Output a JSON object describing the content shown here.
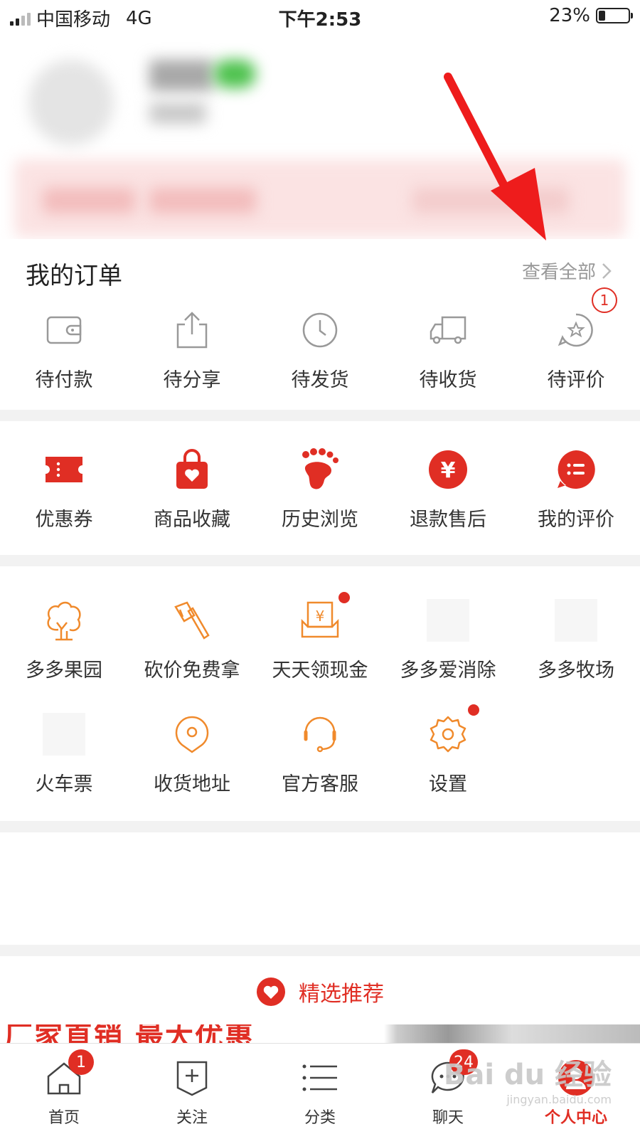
{
  "status_bar": {
    "carrier": "中国移动",
    "network": "4G",
    "time": "下午2:53",
    "battery": "23%",
    "battery_level": 0.23
  },
  "orders": {
    "title": "我的订单",
    "view_all": "查看全部",
    "items": [
      {
        "label": "待付款",
        "icon": "wallet-icon"
      },
      {
        "label": "待分享",
        "icon": "share-icon"
      },
      {
        "label": "待发货",
        "icon": "clock-icon"
      },
      {
        "label": "待收货",
        "icon": "truck-icon"
      },
      {
        "label": "待评价",
        "icon": "review-icon",
        "badge": "1"
      }
    ]
  },
  "services": [
    {
      "label": "优惠券",
      "icon": "coupon-icon"
    },
    {
      "label": "商品收藏",
      "icon": "favorites-bag-icon"
    },
    {
      "label": "历史浏览",
      "icon": "footprint-icon"
    },
    {
      "label": "退款售后",
      "icon": "refund-icon"
    },
    {
      "label": "我的评价",
      "icon": "my-reviews-icon"
    }
  ],
  "tools": [
    {
      "label": "多多果园",
      "icon": "tree-icon"
    },
    {
      "label": "砍价免费拿",
      "icon": "axe-icon"
    },
    {
      "label": "天天领现金",
      "icon": "cash-icon"
    },
    {
      "label": "多多爱消除",
      "icon": "placeholder-icon"
    },
    {
      "label": "多多牧场",
      "icon": "placeholder-icon"
    },
    {
      "label": "火车票",
      "icon": "placeholder-icon"
    },
    {
      "label": "收货地址",
      "icon": "location-icon"
    },
    {
      "label": "官方客服",
      "icon": "headset-icon"
    },
    {
      "label": "设置",
      "icon": "settings-icon"
    }
  ],
  "recommend": {
    "label": "精选推荐",
    "icon": "heart-icon"
  },
  "promo": {
    "text": "厂家直销 最大优惠"
  },
  "tabbar": [
    {
      "label": "首页",
      "icon": "home-icon",
      "badge": "1"
    },
    {
      "label": "关注",
      "icon": "follow-icon"
    },
    {
      "label": "分类",
      "icon": "category-icon"
    },
    {
      "label": "聊天",
      "icon": "chat-icon",
      "badge": "24"
    },
    {
      "label": "个人中心",
      "icon": "profile-icon",
      "active": true
    }
  ],
  "watermark": {
    "brand": "Bai du 经验",
    "url": "jingyan.baidu.com"
  },
  "colors": {
    "accent": "#e02e24",
    "orange": "#f08a2c",
    "gray_icon": "#999999"
  }
}
